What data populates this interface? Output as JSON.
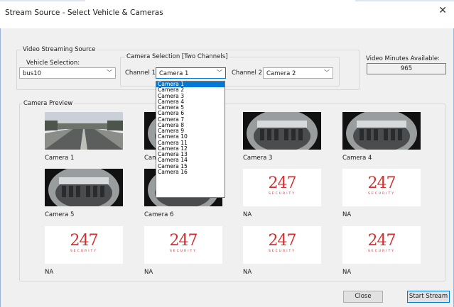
{
  "window": {
    "title": "Stream Source - Select Vehicle & Cameras"
  },
  "source_group": {
    "title": "Video Streaming Source"
  },
  "vehicle": {
    "label": "Vehicle Selection:",
    "value": "bus10"
  },
  "camera_group": {
    "title": "Camera Selection [Two Channels]"
  },
  "channel1": {
    "label": "Channel 1:",
    "value": "Camera 1"
  },
  "channel2": {
    "label": "Channel 2:",
    "value": "Camera 2"
  },
  "minutes": {
    "label": "Video Minutes Available:",
    "value": "965"
  },
  "dropdown": {
    "options": [
      "Camera 1",
      "Camera 2",
      "Camera 3",
      "Camera 4",
      "Camera 5",
      "Camera 6",
      "Camera 7",
      "Camera 8",
      "Camera 9",
      "Camera 10",
      "Camera 11",
      "Camera 12",
      "Camera 13",
      "Camera 14",
      "Camera 15",
      "Camera 16"
    ],
    "selected": "Camera 1"
  },
  "preview": {
    "title": "Camera Preview",
    "thumbs": [
      {
        "label": "Camera 1",
        "kind": "road"
      },
      {
        "label": "Camera 2",
        "kind": "fisheye"
      },
      {
        "label": "Camera 3",
        "kind": "fisheye"
      },
      {
        "label": "Camera 4",
        "kind": "fisheye"
      },
      {
        "label": "Camera 5",
        "kind": "fisheye"
      },
      {
        "label": "Camera 6",
        "kind": "fisheye"
      },
      {
        "label": "NA",
        "kind": "logo"
      },
      {
        "label": "NA",
        "kind": "logo"
      },
      {
        "label": "NA",
        "kind": "logo"
      },
      {
        "label": "NA",
        "kind": "logo"
      },
      {
        "label": "NA",
        "kind": "logo"
      },
      {
        "label": "NA",
        "kind": "logo"
      }
    ],
    "logo_text": "247",
    "logo_sub": "SECURITY",
    "logo_color": "#d42e2e"
  },
  "buttons": {
    "close": "Close",
    "start": "Start Stream"
  }
}
